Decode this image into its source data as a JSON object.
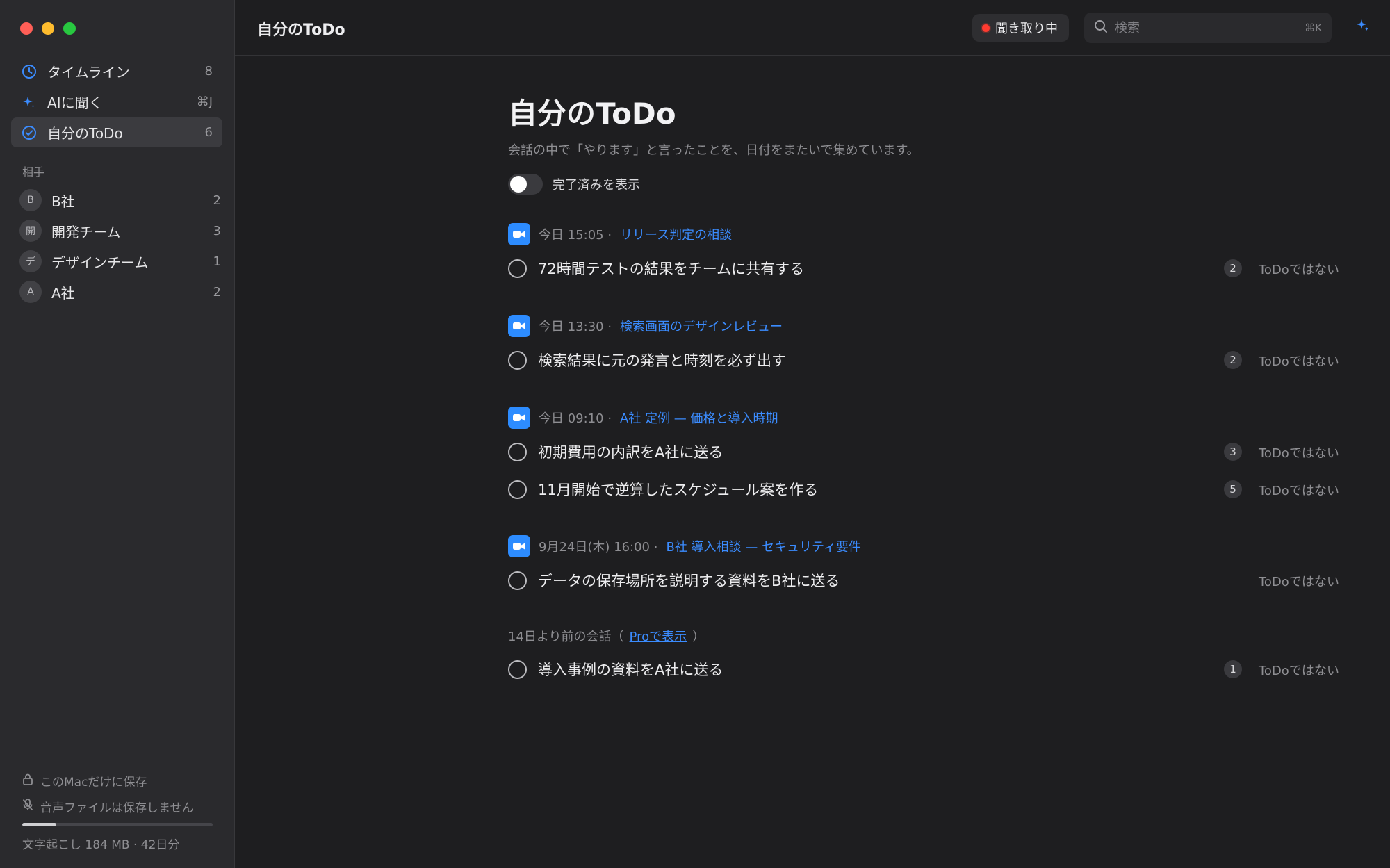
{
  "sidebar": {
    "nav": [
      {
        "label": "タイムライン",
        "count": "8",
        "icon": "clock-icon"
      },
      {
        "label": "AIに聞く",
        "count": "⌘J",
        "icon": "sparkle-icon"
      },
      {
        "label": "自分のToDo",
        "count": "6",
        "icon": "check-circle-icon"
      }
    ],
    "section_label": "相手",
    "contacts": [
      {
        "initial": "B",
        "label": "B社",
        "count": "2"
      },
      {
        "initial": "開",
        "label": "開発チーム",
        "count": "3"
      },
      {
        "initial": "デ",
        "label": "デザインチーム",
        "count": "1"
      },
      {
        "initial": "A",
        "label": "A社",
        "count": "2"
      }
    ],
    "footer": {
      "local_only": "このMacだけに保存",
      "no_audio": "音声ファイルは保存しません",
      "storage": "文字起こし 184 MB · 42日分",
      "storage_progress": 0.18
    }
  },
  "topbar": {
    "title": "自分のToDo",
    "listening": "聞き取り中",
    "search_placeholder": "検索",
    "search_shortcut": "⌘K"
  },
  "main": {
    "title": "自分のToDo",
    "subtitle": "会話の中で「やります」と言ったことを、日付をまたいで集めています。",
    "toggle_label": "完了済みを表示",
    "not_todo_label": "ToDoではない",
    "meetings": [
      {
        "time": "今日 15:05 ·",
        "title": "リリース判定の相談",
        "todos": [
          {
            "text": "72時間テストの結果をチームに共有する",
            "count": "2"
          }
        ]
      },
      {
        "time": "今日 13:30 ·",
        "title": "検索画面のデザインレビュー",
        "todos": [
          {
            "text": "検索結果に元の発言と時刻を必ず出す",
            "count": "2"
          }
        ]
      },
      {
        "time": "今日 09:10 ·",
        "title": "A社 定例 — 価格と導入時期",
        "todos": [
          {
            "text": "初期費用の内訳をA社に送る",
            "count": "3"
          },
          {
            "text": "11月開始で逆算したスケジュール案を作る",
            "count": "5"
          }
        ]
      },
      {
        "time": "9月24日(木) 16:00 ·",
        "title": "B社 導入相談 — セキュリティ要件",
        "todos": [
          {
            "text": "データの保存場所を説明する資料をB社に送る",
            "count": ""
          }
        ]
      }
    ],
    "older": {
      "prefix": "14日より前の会話（",
      "link": "Proで表示",
      "suffix": "）",
      "todos": [
        {
          "text": "導入事例の資料をA社に送る",
          "count": "1"
        }
      ]
    }
  },
  "colors": {
    "accent": "#2d8cff",
    "link": "#3b8cff",
    "record": "#ff3b30"
  }
}
